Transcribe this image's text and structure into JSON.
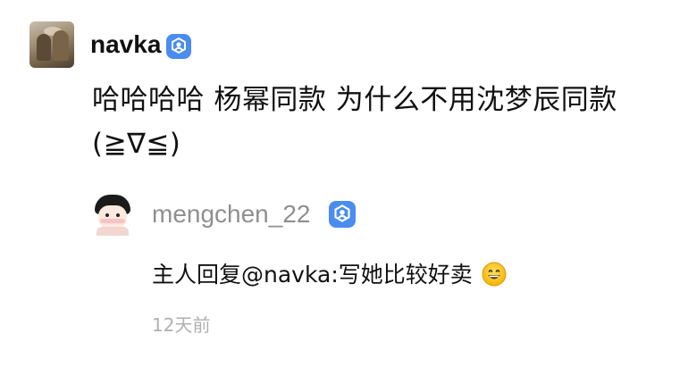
{
  "comment": {
    "username": "navka",
    "verified_icon": "verified-badge-icon",
    "text": "哈哈哈哈 杨幂同款 为什么不用沈梦辰同款(≧∇≦)"
  },
  "reply": {
    "username": "mengchen_22",
    "verified_icon": "verified-badge-icon",
    "text": "主人回复@navka:写她比较好卖",
    "emoji_icon": "grinning-face-icon",
    "timestamp": "12天前"
  },
  "colors": {
    "badge_blue": "#4a8cf0",
    "username_gray": "#8f8f8f",
    "timestamp_gray": "#b0b0b0",
    "text": "#111111"
  }
}
